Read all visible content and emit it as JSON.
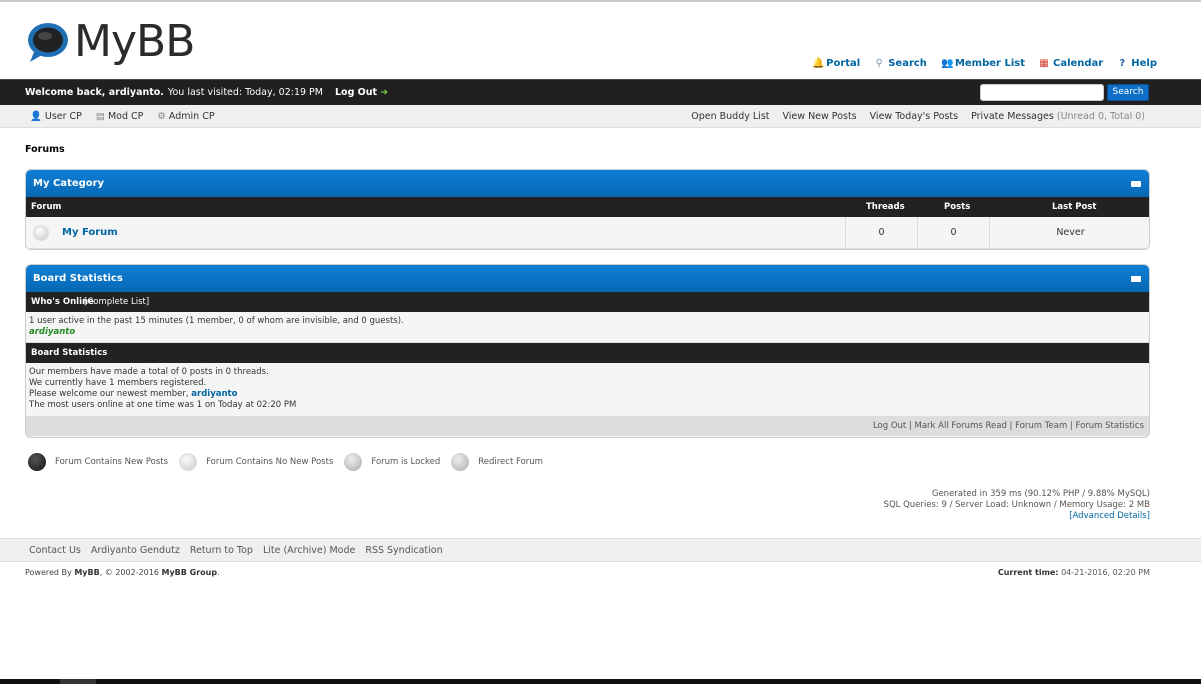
{
  "brand": {
    "logo_text": "MyBB"
  },
  "toplinks": [
    {
      "label": "Portal",
      "icon": "bell-icon",
      "color": "#c9a227"
    },
    {
      "label": "Search",
      "icon": "search-icon",
      "color": "#7a98b5"
    },
    {
      "label": "Member List",
      "icon": "members-icon",
      "color": "#9a6b3a"
    },
    {
      "label": "Calendar",
      "icon": "calendar-icon",
      "color": "#d0392b"
    },
    {
      "label": "Help",
      "icon": "help-icon",
      "color": "#2e64b0"
    }
  ],
  "welcome": {
    "greeting": "Welcome back, ardiyanto.",
    "last_visit": "You last visited: Today, 02:19 PM",
    "logout": "Log Out"
  },
  "search": {
    "placeholder": "",
    "button": "Search"
  },
  "panel": {
    "left": [
      "User CP",
      "Mod CP",
      "Admin CP"
    ],
    "right": [
      "Open Buddy List",
      "View New Posts",
      "View Today's Posts",
      "Private Messages"
    ],
    "pm_counts": "(Unread 0, Total 0)"
  },
  "breadcrumb": "Forums",
  "category": {
    "title": "My Category",
    "columns": {
      "forum": "Forum",
      "threads": "Threads",
      "posts": "Posts",
      "lastpost": "Last Post"
    },
    "forums": [
      {
        "name": "My Forum",
        "threads": "0",
        "posts": "0",
        "lastpost": "Never"
      }
    ]
  },
  "stats": {
    "title": "Board Statistics",
    "online_header": "Who's Online",
    "complete_list": "[Complete List]",
    "online_text": "1 user active in the past 15 minutes (1 member, 0 of whom are invisible, and 0 guests).",
    "online_user": "ardiyanto",
    "stats_header": "Board Statistics",
    "line1": "Our members have made a total of 0 posts in 0 threads.",
    "line2": "We currently have 1 members registered.",
    "line3_prefix": "Please welcome our newest member, ",
    "line3_user": "ardiyanto",
    "line4": "The most users online at one time was 1 on Today at 02:20 PM",
    "footer": "Log Out | Mark All Forums Read | Forum Team | Forum Statistics"
  },
  "legend": [
    "Forum Contains New Posts",
    "Forum Contains No New Posts",
    "Forum is Locked",
    "Redirect Forum"
  ],
  "debug": {
    "line1": "Generated in 359 ms (90.12% PHP / 9.88% MySQL)",
    "line2": "SQL Queries: 9 / Server Load: Unknown / Memory Usage: 2 MB",
    "advanced": "[Advanced Details]"
  },
  "footer_links": [
    "Contact Us",
    "Ardiyanto Gendutz",
    "Return to Top",
    "Lite (Archive) Mode",
    "RSS Syndication"
  ],
  "copyright": {
    "prefix": "Powered By ",
    "mybb": "MyBB",
    "middle": ", © 2002-2016 ",
    "group": "MyBB Group",
    "suffix": "."
  },
  "current_time": {
    "label": "Current time:",
    "value": "04-21-2016, 02:20 PM"
  }
}
